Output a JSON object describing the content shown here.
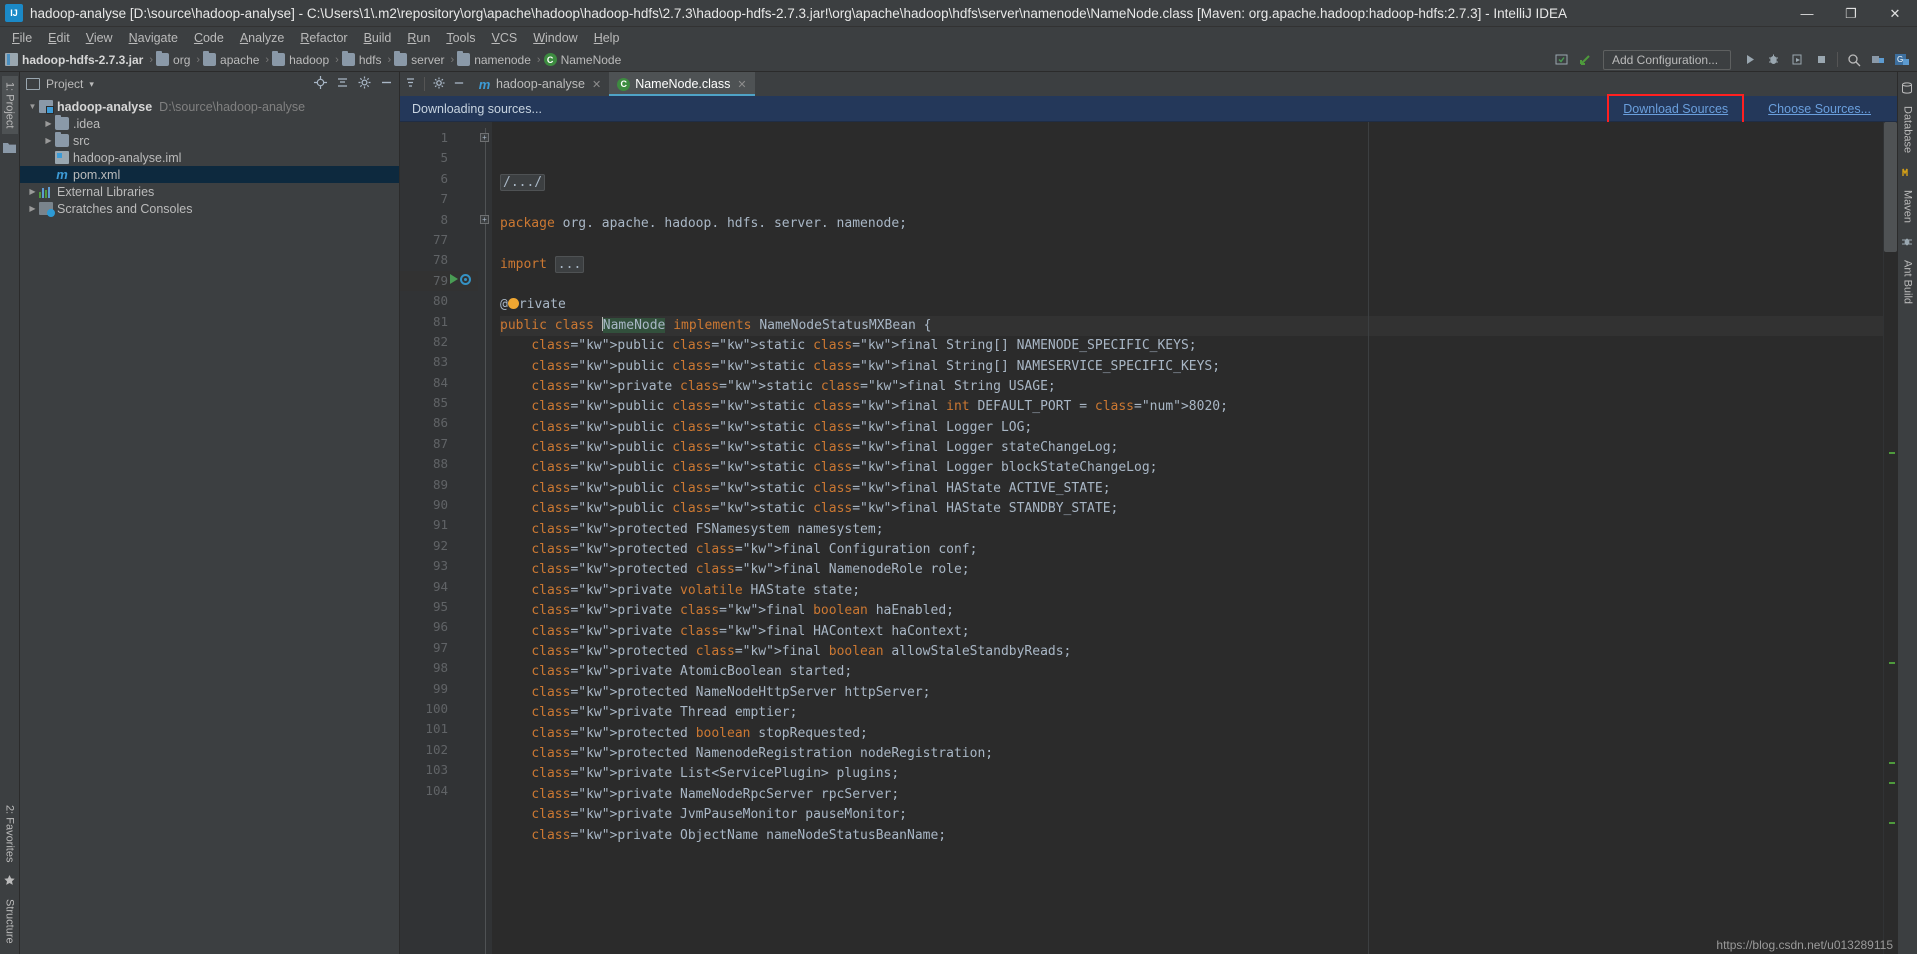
{
  "window": {
    "title": "hadoop-analyse [D:\\source\\hadoop-analyse] - C:\\Users\\1\\.m2\\repository\\org\\apache\\hadoop\\hadoop-hdfs\\2.7.3\\hadoop-hdfs-2.7.3.jar!\\org\\apache\\hadoop\\hdfs\\server\\namenode\\NameNode.class [Maven: org.apache.hadoop:hadoop-hdfs:2.7.3] - IntelliJ IDEA",
    "minimize": "—",
    "maximize": "❐",
    "close": "✕"
  },
  "menubar": {
    "items": [
      "File",
      "Edit",
      "View",
      "Navigate",
      "Code",
      "Analyze",
      "Refactor",
      "Build",
      "Run",
      "Tools",
      "VCS",
      "Window",
      "Help"
    ]
  },
  "navbar": {
    "crumbs": [
      {
        "label": "hadoop-hdfs-2.7.3.jar",
        "icon": "jar-icon"
      },
      {
        "label": "org",
        "icon": "folder-icon"
      },
      {
        "label": "apache",
        "icon": "folder-icon"
      },
      {
        "label": "hadoop",
        "icon": "folder-icon"
      },
      {
        "label": "hdfs",
        "icon": "folder-icon"
      },
      {
        "label": "server",
        "icon": "folder-icon"
      },
      {
        "label": "namenode",
        "icon": "folder-icon"
      },
      {
        "label": "NameNode",
        "icon": "class-icon"
      }
    ],
    "separator": "›",
    "add_configuration": "Add Configuration...",
    "toolbar_icons": [
      "build-icon",
      "update-icon",
      "run-icon",
      "debug-icon",
      "run-coverage-icon",
      "stop-icon",
      "search-icon",
      "project-structure-icon",
      "git-icon"
    ]
  },
  "left_strip": {
    "project_tab": "1: Project",
    "favorites_tab": "2: Favorites",
    "structure_tab": "Structure",
    "bottom_icons": [
      "folder-icon",
      "star-icon"
    ]
  },
  "project_panel": {
    "header": "Project",
    "header_caret": "▾",
    "actions": [
      "locate-icon",
      "collapse-all-icon",
      "settings-icon",
      "hide-icon"
    ],
    "tree": [
      {
        "indent": 0,
        "arrow": "down",
        "icon": "module-icon",
        "label": "hadoop-analyse",
        "bold": true,
        "path": "D:\\source\\hadoop-analyse",
        "selected": false
      },
      {
        "indent": 1,
        "arrow": "right",
        "icon": "folder-icon",
        "label": ".idea",
        "bold": false,
        "path": "",
        "selected": false
      },
      {
        "indent": 1,
        "arrow": "right",
        "icon": "folder-icon",
        "label": "src",
        "bold": false,
        "path": "",
        "selected": false
      },
      {
        "indent": 1,
        "arrow": "none",
        "icon": "iml-icon",
        "label": "hadoop-analyse.iml",
        "bold": false,
        "path": "",
        "selected": false
      },
      {
        "indent": 1,
        "arrow": "none",
        "icon": "maven-icon",
        "label": "pom.xml",
        "bold": false,
        "path": "",
        "selected": true
      },
      {
        "indent": 0,
        "arrow": "right",
        "icon": "library-icon",
        "label": "External Libraries",
        "bold": false,
        "path": "",
        "selected": false
      },
      {
        "indent": 0,
        "arrow": "right",
        "icon": "scratch-icon",
        "label": "Scratches and Consoles",
        "bold": false,
        "path": "",
        "selected": false
      }
    ]
  },
  "editor": {
    "tab_tools": [
      "sort-icon",
      "settings-icon",
      "hide-icon"
    ],
    "tabs": [
      {
        "label": "hadoop-analyse",
        "icon": "maven-icon",
        "active": false,
        "close": "✕"
      },
      {
        "label": "NameNode.class",
        "icon": "class-icon",
        "active": true,
        "close": "✕"
      }
    ],
    "banner": {
      "message": "Downloading sources...",
      "download_link": "Download Sources",
      "choose_link": "Choose Sources...",
      "highlight_color": "#ff2020",
      "background": "#24385a"
    },
    "code_lines": [
      {
        "num": "1",
        "kind": "fold-comment",
        "text": "/.../",
        "fold": true,
        "cur": false
      },
      {
        "num": "5",
        "kind": "blank",
        "text": "",
        "cur": false
      },
      {
        "num": "6",
        "kind": "package",
        "keyword": "package",
        "text": " org. apache. hadoop. hdfs. server. namenode;",
        "cur": false
      },
      {
        "num": "7",
        "kind": "blank",
        "text": "",
        "cur": false
      },
      {
        "num": "8",
        "kind": "import",
        "keyword": "import",
        "text": " ...",
        "fold": true,
        "cur": false
      },
      {
        "num": "77",
        "kind": "blank",
        "text": "",
        "cur": false
      },
      {
        "num": "78",
        "kind": "annotation",
        "text": "@Private",
        "cur": false
      },
      {
        "num": "79",
        "kind": "class-decl",
        "text": "public class NameNode implements NameNodeStatusMXBean {",
        "cur": true,
        "gutter_run": true
      },
      {
        "num": "80",
        "kind": "member",
        "text": "    public static final String[] NAMENODE_SPECIFIC_KEYS;",
        "cur": false
      },
      {
        "num": "81",
        "kind": "member",
        "text": "    public static final String[] NAMESERVICE_SPECIFIC_KEYS;",
        "cur": false
      },
      {
        "num": "82",
        "kind": "member",
        "text": "    private static final String USAGE;",
        "cur": false
      },
      {
        "num": "83",
        "kind": "member",
        "text": "    public static final int DEFAULT_PORT = 8020;",
        "cur": false
      },
      {
        "num": "84",
        "kind": "member",
        "text": "    public static final Logger LOG;",
        "cur": false
      },
      {
        "num": "85",
        "kind": "member",
        "text": "    public static final Logger stateChangeLog;",
        "cur": false
      },
      {
        "num": "86",
        "kind": "member",
        "text": "    public static final Logger blockStateChangeLog;",
        "cur": false
      },
      {
        "num": "87",
        "kind": "member",
        "text": "    public static final HAState ACTIVE_STATE;",
        "cur": false
      },
      {
        "num": "88",
        "kind": "member",
        "text": "    public static final HAState STANDBY_STATE;",
        "cur": false
      },
      {
        "num": "89",
        "kind": "member",
        "text": "    protected FSNamesystem namesystem;",
        "cur": false
      },
      {
        "num": "90",
        "kind": "member",
        "text": "    protected final Configuration conf;",
        "cur": false
      },
      {
        "num": "91",
        "kind": "member",
        "text": "    protected final NamenodeRole role;",
        "cur": false
      },
      {
        "num": "92",
        "kind": "member",
        "text": "    private volatile HAState state;",
        "cur": false
      },
      {
        "num": "93",
        "kind": "member",
        "text": "    private final boolean haEnabled;",
        "cur": false
      },
      {
        "num": "94",
        "kind": "member",
        "text": "    private final HAContext haContext;",
        "cur": false
      },
      {
        "num": "95",
        "kind": "member",
        "text": "    protected final boolean allowStaleStandbyReads;",
        "cur": false
      },
      {
        "num": "96",
        "kind": "member",
        "text": "    private AtomicBoolean started;",
        "cur": false
      },
      {
        "num": "97",
        "kind": "member",
        "text": "    protected NameNodeHttpServer httpServer;",
        "cur": false
      },
      {
        "num": "98",
        "kind": "member",
        "text": "    private Thread emptier;",
        "cur": false
      },
      {
        "num": "99",
        "kind": "member",
        "text": "    protected boolean stopRequested;",
        "cur": false
      },
      {
        "num": "100",
        "kind": "member",
        "text": "    protected NamenodeRegistration nodeRegistration;",
        "cur": false
      },
      {
        "num": "101",
        "kind": "member",
        "text": "    private List<ServicePlugin> plugins;",
        "cur": false
      },
      {
        "num": "102",
        "kind": "member",
        "text": "    private NameNodeRpcServer rpcServer;",
        "cur": false
      },
      {
        "num": "103",
        "kind": "member",
        "text": "    private JvmPauseMonitor pauseMonitor;",
        "cur": false
      },
      {
        "num": "104",
        "kind": "member",
        "text": "    private ObjectName nameNodeStatusBeanName;",
        "cur": false
      }
    ]
  },
  "right_strip": {
    "tabs": [
      "Database",
      "Maven",
      "Ant Build"
    ],
    "icons": [
      "database-icon",
      "maven-icon",
      "ant-icon"
    ]
  },
  "watermark": "https://blog.csdn.net/u013289115"
}
